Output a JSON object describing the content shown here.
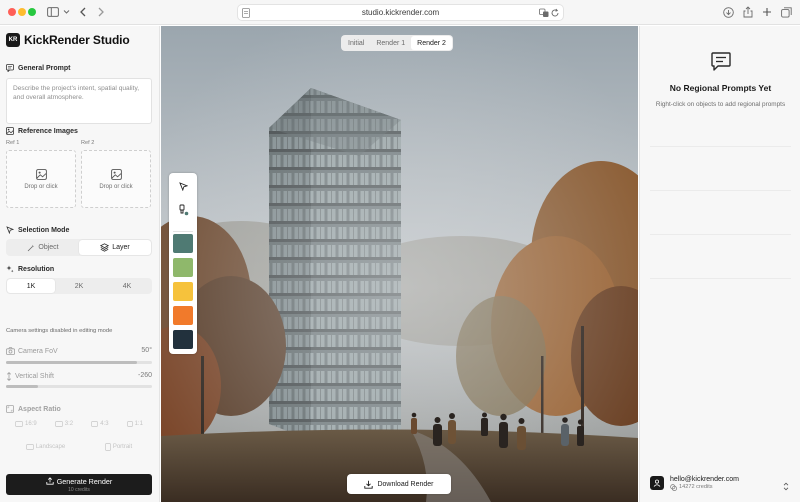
{
  "browser": {
    "url": "studio.kickrender.com"
  },
  "brand": {
    "logo_text": "KR",
    "name": "KickRender Studio"
  },
  "general_prompt": {
    "title": "General Prompt",
    "placeholder": "Describe the project's intent, spatial quality, and overall atmosphere."
  },
  "reference_images": {
    "title": "Reference Images",
    "slots": [
      {
        "label": "Ref 1",
        "hint": "Drop or click"
      },
      {
        "label": "Ref 2",
        "hint": "Drop or click"
      }
    ]
  },
  "selection_mode": {
    "title": "Selection Mode",
    "options": [
      {
        "label": "Object",
        "active": false
      },
      {
        "label": "Layer",
        "active": true
      }
    ]
  },
  "resolution": {
    "title": "Resolution",
    "options": [
      {
        "label": "1K",
        "active": true
      },
      {
        "label": "2K",
        "active": false
      },
      {
        "label": "4K",
        "active": false
      }
    ]
  },
  "camera": {
    "note": "Camera settings disabled in editing mode",
    "fov": {
      "label": "Camera FoV",
      "value": "50°",
      "level": 0.9
    },
    "shift": {
      "label": "Vertical Shift",
      "value": "-260",
      "level": 0.22
    }
  },
  "aspect_ratio": {
    "title": "Aspect Ratio",
    "ratios": [
      "16:9",
      "3:2",
      "4:3",
      "1:1"
    ],
    "orientations": [
      "Landscape",
      "Portrait"
    ]
  },
  "generate": {
    "label": "Generate Render",
    "sub": "10 credits"
  },
  "canvas": {
    "tabs": [
      {
        "label": "Initial",
        "active": false
      },
      {
        "label": "Render 1",
        "active": false
      },
      {
        "label": "Render 2",
        "active": true
      }
    ],
    "download_label": "Download Render"
  },
  "palette": {
    "colors": [
      "#4f7a73",
      "#8fb86b",
      "#f6c23c",
      "#f17a2b",
      "#22313d"
    ]
  },
  "regional_prompts": {
    "title": "No Regional Prompts Yet",
    "subtitle": "Right-click on objects to add regional prompts"
  },
  "user": {
    "email": "hello@kickrender.com",
    "credits": "14272 credits"
  }
}
